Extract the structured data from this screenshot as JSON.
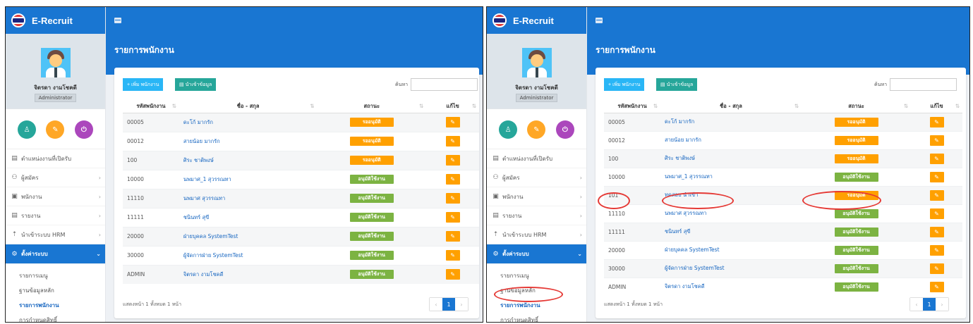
{
  "app": {
    "brand": "E-Recruit",
    "user_name": "จิตรดา งามโชคดี",
    "user_role": "Administrator",
    "page_title": "รายการพนักงาน"
  },
  "menu": {
    "items": [
      {
        "label": "ตำแหน่งงานที่เปิดรับ",
        "icon": "list-icon",
        "chevron": false
      },
      {
        "label": "ผู้สมัคร",
        "icon": "users-icon",
        "chevron": true
      },
      {
        "label": "พนักงาน",
        "icon": "id-card-icon",
        "chevron": true
      },
      {
        "label": "รายงาน",
        "icon": "report-icon",
        "chevron": true
      },
      {
        "label": "นำเข้าระบบ HRM",
        "icon": "upload-icon",
        "chevron": true
      }
    ],
    "settings": {
      "label": "ตั้งค่าระบบ",
      "chevron": "⌄"
    },
    "sub_items": [
      "รายการเมนู",
      "ฐานข้อมูลหลัก",
      "รายการพนักงาน",
      "การกำหนดสิทธิ์"
    ],
    "current_sub": "รายการพนักงาน"
  },
  "toolbar": {
    "add_label": "+ เพิ่ม พนักงาน",
    "import_label": "นำเข้าข้อมูล",
    "search_label": "ค้นหา"
  },
  "table": {
    "columns": [
      "รหัสพนักงาน",
      "ชื่อ - สกุล",
      "สถานะ",
      "แก้ไข"
    ],
    "sort_glyph": "⇅"
  },
  "panels": [
    {
      "rows": [
        {
          "id": "00005",
          "name": "ดะโก้ มากรัก",
          "status": "รออนุมัติ",
          "status_kind": "wait"
        },
        {
          "id": "00012",
          "name": "สายน้อย มากรัก",
          "status": "รออนุมัติ",
          "status_kind": "wait"
        },
        {
          "id": "100",
          "name": "ศิระ ชาติพงษ์",
          "status": "รออนุมัติ",
          "status_kind": "wait"
        },
        {
          "id": "10000",
          "name": "นพมาศ_1 สุวรรณทา",
          "status": "อนุมัติใช้งาน",
          "status_kind": "ok"
        },
        {
          "id": "11110",
          "name": "นพมาศ สุวรรณทา",
          "status": "อนุมัติใช้งาน",
          "status_kind": "ok"
        },
        {
          "id": "11111",
          "name": "ชนินทร์ สุขี",
          "status": "อนุมัติใช้งาน",
          "status_kind": "ok"
        },
        {
          "id": "20000",
          "name": "ฝ่ายบุคคล SystemTest",
          "status": "อนุมัติใช้งาน",
          "status_kind": "ok"
        },
        {
          "id": "30000",
          "name": "ผู้จัดการฝ่าย SystemTest",
          "status": "อนุมัติใช้งาน",
          "status_kind": "ok"
        },
        {
          "id": "ADMIN",
          "name": "จิตรดา งามโชคดี",
          "status": "อนุมัติใช้งาน",
          "status_kind": "ok"
        }
      ],
      "footer": "แสดงหน้า 1 ทั้งหมด 1 หน้า",
      "pager": [
        "‹",
        "1",
        "›"
      ]
    },
    {
      "rows": [
        {
          "id": "00005",
          "name": "ดะโก้ มากรัก",
          "status": "รออนุมัติ",
          "status_kind": "wait"
        },
        {
          "id": "00012",
          "name": "สายน้อย มากรัก",
          "status": "รออนุมัติ",
          "status_kind": "wait"
        },
        {
          "id": "100",
          "name": "ศิระ ชาติพงษ์",
          "status": "รออนุมัติ",
          "status_kind": "wait"
        },
        {
          "id": "10000",
          "name": "นพมาศ_1 สุวรรณทา",
          "status": "อนุมัติใช้งาน",
          "status_kind": "ok"
        },
        {
          "id": "101",
          "name": "ทดสอบ นำเข้า",
          "status": "รออนุมัติ",
          "status_kind": "wait"
        },
        {
          "id": "11110",
          "name": "นพมาศ สุวรรณทา",
          "status": "อนุมัติใช้งาน",
          "status_kind": "ok"
        },
        {
          "id": "11111",
          "name": "ชนินทร์ สุขี",
          "status": "อนุมัติใช้งาน",
          "status_kind": "ok"
        },
        {
          "id": "20000",
          "name": "ฝ่ายบุคคล SystemTest",
          "status": "อนุมัติใช้งาน",
          "status_kind": "ok"
        },
        {
          "id": "30000",
          "name": "ผู้จัดการฝ่าย SystemTest",
          "status": "อนุมัติใช้งาน",
          "status_kind": "ok"
        },
        {
          "id": "ADMIN",
          "name": "จิตรดา งามโชคดี",
          "status": "อนุมัติใช้งาน",
          "status_kind": "ok"
        }
      ],
      "footer": "แสดงหน้า 1 ทั้งหมด 1 หน้า",
      "pager": [
        "‹",
        "1",
        "›"
      ]
    }
  ],
  "colors": {
    "primary": "#1976d2",
    "wait": "#ffa000",
    "ok": "#7cb342",
    "highlight": "#e53935"
  }
}
